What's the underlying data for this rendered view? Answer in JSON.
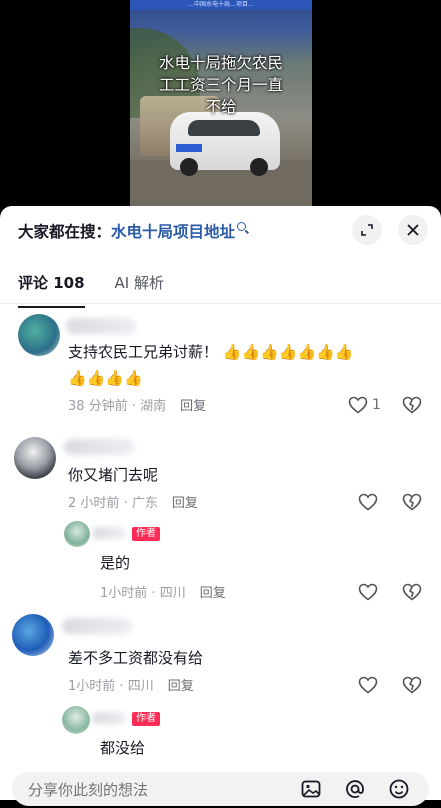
{
  "video": {
    "banner_text": "…中国水电十局…项目…",
    "caption_lines": [
      "水电十局拖欠农民",
      "工工资三个月一直",
      "不给"
    ]
  },
  "search": {
    "prefix": "大家都在搜：",
    "term": "水电十局项目地址"
  },
  "tabs": [
    {
      "label": "评论 108"
    },
    {
      "label": "AI 解析"
    }
  ],
  "comments": [
    {
      "text": "支持农民工兄弟讨薪！",
      "emoji_row1": [
        "👍",
        "👍",
        "👍",
        "👍",
        "👍",
        "👍",
        "👍"
      ],
      "emoji_row2": [
        "👍",
        "👍",
        "👍",
        "👍"
      ],
      "time": "38 分钟前",
      "location": "湖南",
      "reply": "回复",
      "likes": "1"
    },
    {
      "text": "你又堵门去呢",
      "time": "2 小时前",
      "location": "广东",
      "reply": "回复",
      "replies": [
        {
          "author_tag": "作者",
          "text": "是的",
          "time": "1小时前",
          "location": "四川",
          "reply": "回复"
        }
      ]
    },
    {
      "text": "差不多工资都没有给",
      "time": "1小时前",
      "location": "四川",
      "reply": "回复",
      "replies": [
        {
          "author_tag": "作者",
          "text": "都没给"
        }
      ]
    }
  ],
  "input": {
    "placeholder": "分享你此刻的想法"
  },
  "icons": {
    "expand": "expand-icon",
    "close": "close-icon",
    "like": "heart-icon",
    "dislike": "broken-heart-icon",
    "image": "image-icon",
    "mention": "at-icon",
    "emoji": "emoji-icon"
  },
  "colors": {
    "search_term": "#2a5aa8",
    "author_tag": "#fe2c55"
  }
}
